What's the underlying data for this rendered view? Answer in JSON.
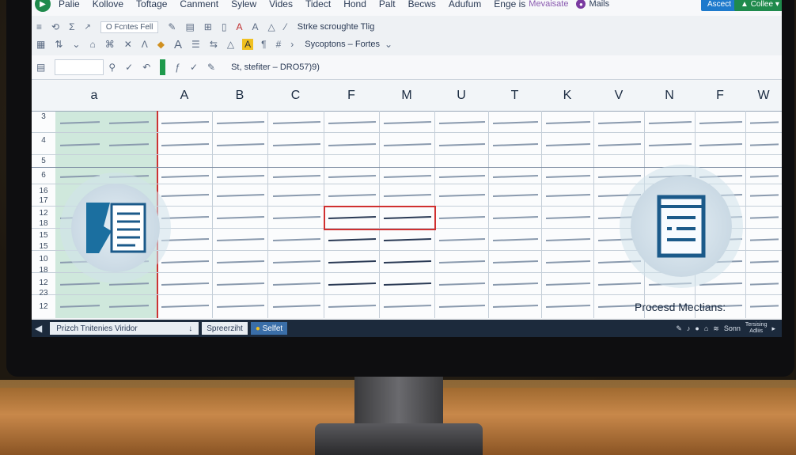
{
  "ribbon": {
    "menu_items": [
      "Palie",
      "Kollove",
      "Toftage",
      "Canment",
      "Sylew",
      "Vides",
      "Tidect",
      "Hond",
      "Palt",
      "Becws",
      "Adufum",
      "Enge is"
    ],
    "accent_link": "Mevaisate",
    "mail_label": "Mails",
    "share_button": "Ascect",
    "collab_button": "Collee",
    "font_box": "O Fcntes",
    "font_box_suffix": "Fell",
    "toolbar_text_1": "Strke scroughte Tlig",
    "toolbar_text_2": "Sycoptons – Fortes"
  },
  "formula_bar": {
    "cell_ref": "St, stefiter – DRO57)9)"
  },
  "grid": {
    "column_headers": [
      "a",
      "A",
      "B",
      "C",
      "F",
      "M",
      "U",
      "T",
      "K",
      "V",
      "N",
      "F",
      "W"
    ],
    "row_numbers": [
      "3",
      "4",
      "5",
      "6",
      "16",
      "17",
      "12",
      "18",
      "15",
      "15",
      "10",
      "18",
      "12",
      "23",
      "12"
    ],
    "caption": "Procesd Mectians:"
  },
  "taskbar": {
    "search_text": "Prizch Tnitenies Viridor",
    "item_1": "Spreerziht",
    "item_2": "Selfet",
    "tray_text": "Sonn",
    "clock_line_1": "Tersising",
    "clock_line_2": "Adliis"
  },
  "colors": {
    "accent_green": "#1f8a4c",
    "accent_blue": "#1e7acc",
    "selection_red": "#d03030",
    "highlight_column": "#cfe8dc"
  }
}
